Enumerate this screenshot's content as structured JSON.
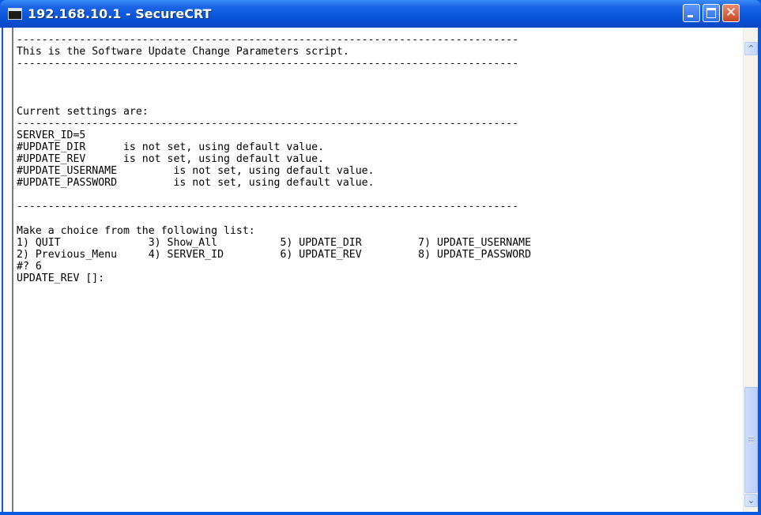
{
  "window": {
    "title": "192.168.10.1 - SecureCRT",
    "app_icon": "terminal-icon",
    "controls": {
      "minimize": "minimize-icon",
      "maximize": "maximize-icon",
      "close": "close-icon",
      "close_glyph": "✕"
    },
    "colors": {
      "titlebar": "#0a55d9",
      "close_button": "#c74724",
      "terminal_background": "#ffffff",
      "terminal_text": "#000000"
    }
  },
  "terminal": {
    "lines": [
      "--------------------------------------------------------------------------------",
      "This is the Software Update Change Parameters script.",
      "--------------------------------------------------------------------------------",
      "",
      "",
      "",
      "Current settings are:",
      "--------------------------------------------------------------------------------",
      "SERVER_ID=5",
      "#UPDATE_DIR      is not set, using default value.",
      "#UPDATE_REV      is not set, using default value.",
      "#UPDATE_USERNAME         is not set, using default value.",
      "#UPDATE_PASSWORD         is not set, using default value.",
      "",
      "--------------------------------------------------------------------------------",
      "",
      "Make a choice from the following list:",
      "1) QUIT              3) Show_All          5) UPDATE_DIR         7) UPDATE_USERNAME",
      "2) Previous_Menu     4) SERVER_ID         6) UPDATE_REV         8) UPDATE_PASSWORD",
      "#? 6",
      "UPDATE_REV []:"
    ]
  },
  "scrollbar": {
    "up_icon": "scroll-up-arrow-icon",
    "down_icon": "scroll-down-arrow-icon",
    "up_glyph": "⌃",
    "down_glyph": "⌄",
    "position_fraction": 0.95
  }
}
